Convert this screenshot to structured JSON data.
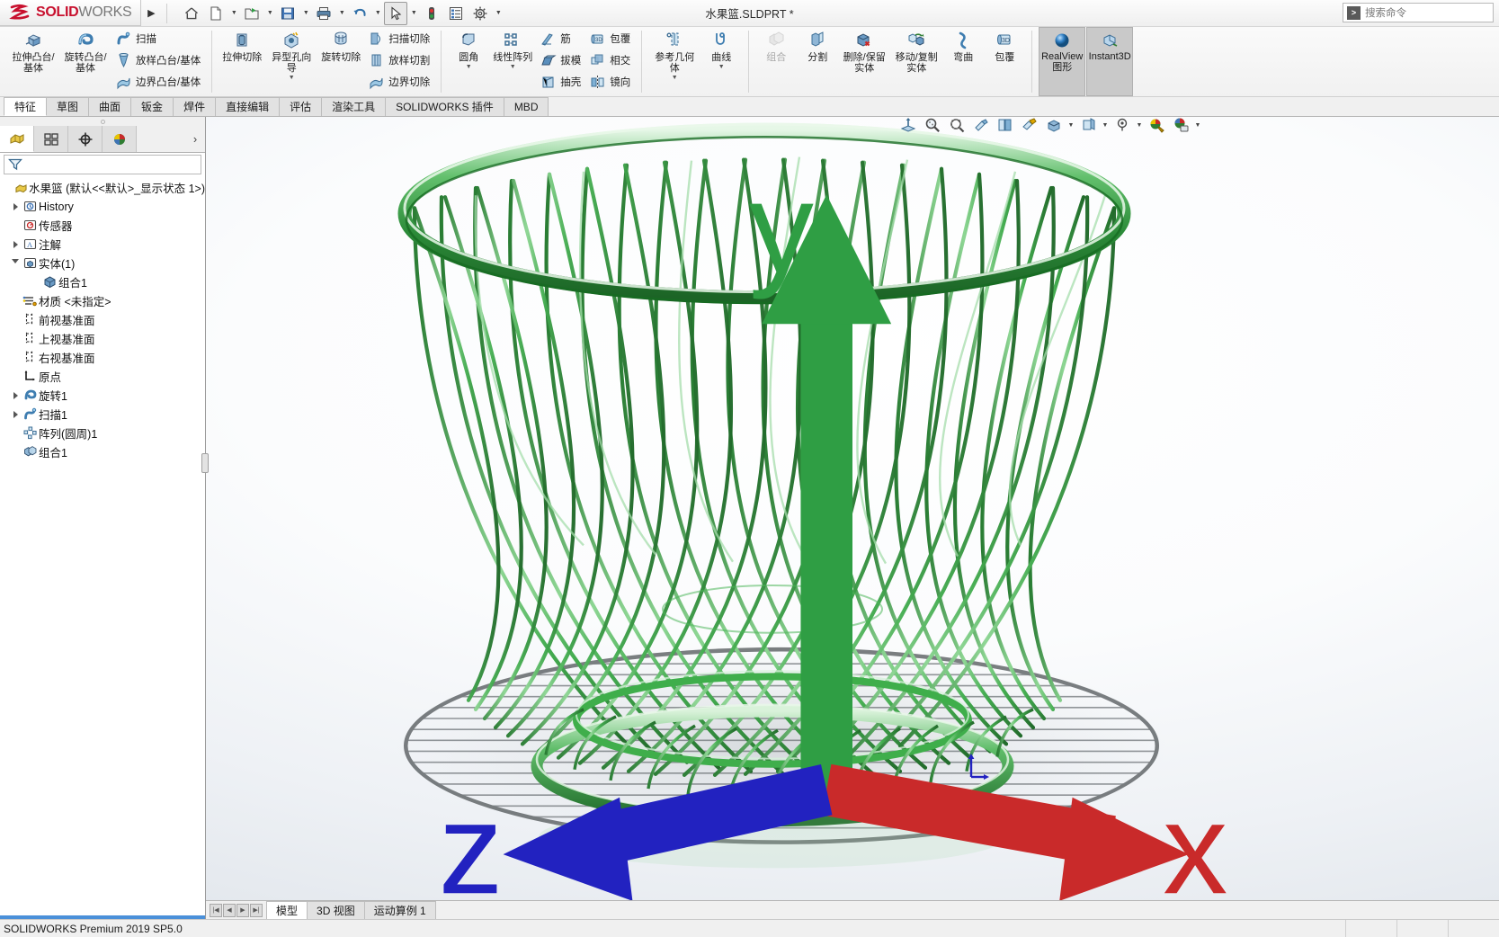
{
  "titlebar": {
    "brand_bold": "SOLID",
    "brand_light": "WORKS",
    "doc_title": "水果篮.SLDPRT *",
    "search_placeholder": "搜索命令",
    "search_icon": "search-commands-icon",
    "quick_access": [
      {
        "name": "home-icon",
        "label": "主页"
      },
      {
        "name": "new-document-icon",
        "label": "新建"
      },
      {
        "name": "open-folder-icon",
        "label": "打开"
      },
      {
        "name": "save-icon",
        "label": "保存"
      },
      {
        "name": "print-icon",
        "label": "打印"
      },
      {
        "name": "undo-icon",
        "label": "撤销"
      },
      {
        "name": "select-cursor-icon",
        "label": "选择"
      },
      {
        "name": "rebuild-traffic-light-icon",
        "label": "重建模型"
      },
      {
        "name": "options-list-icon",
        "label": "文件属性"
      },
      {
        "name": "gear-icon",
        "label": "选项"
      }
    ]
  },
  "ribbon": {
    "groups": [
      {
        "name": "boss-base-group",
        "big": [
          {
            "label": "拉伸凸台/基体",
            "icon": "extrude-boss-icon",
            "dropdown": false,
            "disabled": false
          },
          {
            "label": "旋转凸台/基体",
            "icon": "revolve-boss-icon",
            "dropdown": false,
            "disabled": false
          }
        ],
        "small": [
          {
            "label": "扫描",
            "icon": "sweep-icon"
          },
          {
            "label": "放样凸台/基体",
            "icon": "loft-boss-icon"
          },
          {
            "label": "边界凸台/基体",
            "icon": "boundary-boss-icon"
          }
        ]
      },
      {
        "name": "cut-group",
        "big": [
          {
            "label": "拉伸切除",
            "icon": "extrude-cut-icon",
            "dropdown": false,
            "disabled": false
          },
          {
            "label": "异型孔向导",
            "icon": "hole-wizard-icon",
            "dropdown": true,
            "disabled": false
          },
          {
            "label": "旋转切除",
            "icon": "revolve-cut-icon",
            "dropdown": false,
            "disabled": false
          }
        ],
        "small": [
          {
            "label": "扫描切除",
            "icon": "sweep-cut-icon"
          },
          {
            "label": "放样切割",
            "icon": "loft-cut-icon"
          },
          {
            "label": "边界切除",
            "icon": "boundary-cut-icon"
          }
        ]
      },
      {
        "name": "fillet-pattern-group",
        "big": [
          {
            "label": "圆角",
            "icon": "fillet-icon",
            "dropdown": true,
            "disabled": false
          },
          {
            "label": "线性阵列",
            "icon": "linear-pattern-icon",
            "dropdown": true,
            "disabled": false
          }
        ],
        "small": [
          {
            "label": "筋",
            "icon": "rib-icon"
          },
          {
            "label": "拔模",
            "icon": "draft-icon"
          },
          {
            "label": "抽壳",
            "icon": "shell-icon"
          }
        ],
        "small2": [
          {
            "label": "包覆",
            "icon": "wrap-icon"
          },
          {
            "label": "相交",
            "icon": "intersect-icon"
          },
          {
            "label": "镜向",
            "icon": "mirror-icon"
          }
        ]
      },
      {
        "name": "reference-curve-group",
        "big": [
          {
            "label": "参考几何体",
            "icon": "reference-geometry-icon",
            "dropdown": true,
            "disabled": false
          },
          {
            "label": "曲线",
            "icon": "curves-icon",
            "dropdown": true,
            "disabled": false
          }
        ]
      },
      {
        "name": "bodies-group",
        "big": [
          {
            "label": "组合",
            "icon": "combine-icon",
            "dropdown": false,
            "disabled": true
          },
          {
            "label": "分割",
            "icon": "split-icon",
            "dropdown": false,
            "disabled": false
          },
          {
            "label": "删除/保留实体",
            "icon": "delete-keep-body-icon",
            "dropdown": false,
            "disabled": false
          },
          {
            "label": "移动/复制实体",
            "icon": "move-copy-body-icon",
            "dropdown": false,
            "disabled": false
          },
          {
            "label": "弯曲",
            "icon": "flex-icon",
            "dropdown": false,
            "disabled": false
          },
          {
            "label": "包覆",
            "icon": "wrap-big-icon",
            "dropdown": false,
            "disabled": false
          }
        ]
      },
      {
        "name": "display-group",
        "toggles": [
          {
            "label": "RealView 图形",
            "icon": "realview-sphere-icon",
            "active": true
          },
          {
            "label": "Instant3D",
            "icon": "instant3d-icon",
            "active": true
          }
        ]
      }
    ]
  },
  "tabs": {
    "items": [
      {
        "label": "特征",
        "active": true
      },
      {
        "label": "草图",
        "active": false
      },
      {
        "label": "曲面",
        "active": false
      },
      {
        "label": "钣金",
        "active": false
      },
      {
        "label": "焊件",
        "active": false
      },
      {
        "label": "直接编辑",
        "active": false
      },
      {
        "label": "评估",
        "active": false
      },
      {
        "label": "渲染工具",
        "active": false
      },
      {
        "label": "SOLIDWORKS 插件",
        "active": false
      },
      {
        "label": "MBD",
        "active": false
      }
    ]
  },
  "view_toolbar": {
    "buttons": [
      {
        "name": "zoom-to-fit-icon",
        "label": "整屏显示全图"
      },
      {
        "name": "zoom-to-area-icon",
        "label": "局部放大"
      },
      {
        "name": "previous-view-icon",
        "label": "上一视图"
      },
      {
        "name": "section-view-icon",
        "label": "剖面视图"
      },
      {
        "name": "view-orientation-icon",
        "label": "视图定向"
      },
      {
        "name": "display-style-icon",
        "label": "显示样式",
        "dropdown": true
      },
      {
        "name": "hide-show-items-icon",
        "label": "隐藏/显示项目",
        "dropdown": true
      },
      {
        "name": "edit-appearance-icon",
        "label": "编辑外观",
        "dropdown": true
      },
      {
        "name": "apply-scene-icon",
        "label": "应用布景",
        "dropdown": true
      },
      {
        "name": "view-settings-icon",
        "label": "视图设定",
        "dropdown": true
      }
    ]
  },
  "feature_manager": {
    "tabs": [
      {
        "name": "feature-tree-tab",
        "active": true
      },
      {
        "name": "property-manager-tab",
        "active": false
      },
      {
        "name": "configuration-manager-tab",
        "active": false
      },
      {
        "name": "display-manager-tab",
        "active": false
      }
    ],
    "expand_icon": "chevron-right-icon",
    "filter_icon": "filter-icon",
    "filter_value": "",
    "tree": [
      {
        "label": "水果篮  (默认<<默认>_显示状态 1>)",
        "icon": "part-icon",
        "indent": 0,
        "twisty": "none",
        "selected": false
      },
      {
        "label": "History",
        "icon": "history-icon",
        "indent": 1,
        "twisty": "right",
        "selected": false
      },
      {
        "label": "传感器",
        "icon": "sensors-icon",
        "indent": 1,
        "twisty": "none",
        "selected": false
      },
      {
        "label": "注解",
        "icon": "annotations-icon",
        "indent": 1,
        "twisty": "right",
        "selected": false
      },
      {
        "label": "实体(1)",
        "icon": "solid-bodies-icon",
        "indent": 1,
        "twisty": "down",
        "selected": false
      },
      {
        "label": "组合1",
        "icon": "body-icon",
        "indent": 2,
        "twisty": "none",
        "selected": false
      },
      {
        "label": "材质 <未指定>",
        "icon": "material-icon",
        "indent": 1,
        "twisty": "none",
        "selected": false
      },
      {
        "label": "前视基准面",
        "icon": "plane-icon",
        "indent": 1,
        "twisty": "none",
        "selected": false
      },
      {
        "label": "上视基准面",
        "icon": "plane-icon",
        "indent": 1,
        "twisty": "none",
        "selected": false
      },
      {
        "label": "右视基准面",
        "icon": "plane-icon",
        "indent": 1,
        "twisty": "none",
        "selected": false
      },
      {
        "label": "原点",
        "icon": "origin-icon",
        "indent": 1,
        "twisty": "none",
        "selected": false
      },
      {
        "label": "旋转1",
        "icon": "revolve-feature-icon",
        "indent": 1,
        "twisty": "right",
        "selected": false
      },
      {
        "label": "扫描1",
        "icon": "sweep-feature-icon",
        "indent": 1,
        "twisty": "right",
        "selected": false
      },
      {
        "label": "阵列(圆周)1",
        "icon": "circular-pattern-icon",
        "indent": 1,
        "twisty": "none",
        "selected": false
      },
      {
        "label": "组合1",
        "icon": "combine-feature-icon",
        "indent": 1,
        "twisty": "none",
        "selected": false
      }
    ]
  },
  "graphics": {
    "model_name": "水果篮",
    "model_color": "#3fae4b",
    "model_color_light": "#9fdca6",
    "model_color_dark": "#1f6e2c",
    "background_top": "#ffffff",
    "background_bottom": "#dfe4ea",
    "triad": {
      "x_label": "x",
      "y_label": "y",
      "z_label": "z",
      "x_color": "#c00000",
      "y_color": "#008000",
      "z_color": "#0000c0"
    }
  },
  "bottom_tabs": {
    "nav_buttons": [
      "first",
      "prev",
      "next",
      "last"
    ],
    "items": [
      {
        "label": "模型",
        "active": true
      },
      {
        "label": "3D 视图",
        "active": false
      },
      {
        "label": "运动算例 1",
        "active": false
      }
    ]
  },
  "status_bar": {
    "text": "SOLIDWORKS Premium 2019 SP5.0",
    "cells": [
      "",
      "",
      ""
    ]
  }
}
